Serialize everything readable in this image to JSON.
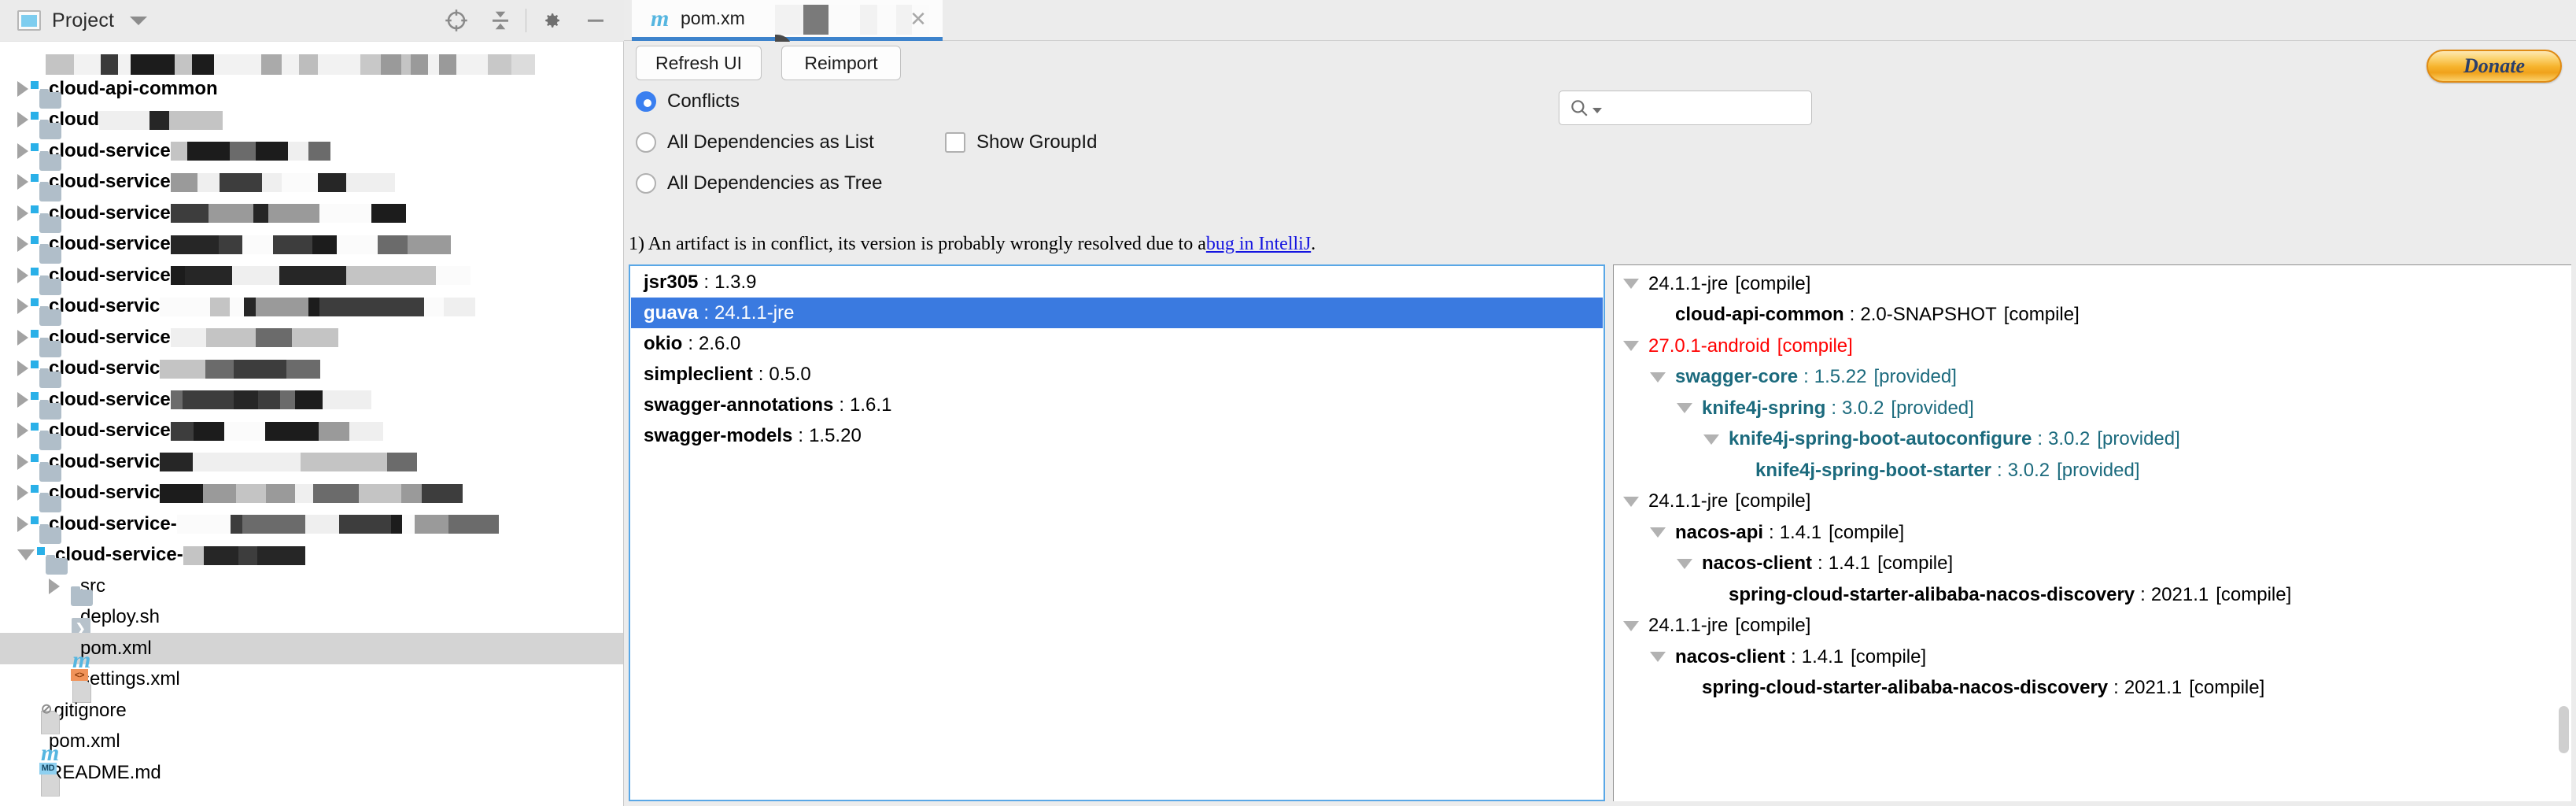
{
  "sidebar": {
    "tab_label": "Project",
    "icons": {
      "project": "project-window-icon",
      "locate": "locate-crosshair-icon",
      "collapse": "collapse-all-icon",
      "settings": "gear-icon",
      "minimize": "minimize-icon",
      "dropdown": "chevron-down-icon"
    },
    "tree": [
      {
        "label": "cloud-api-common",
        "indent": 0,
        "kind": "module",
        "state": "collapsed",
        "redacted": false
      },
      {
        "label": "cloud",
        "indent": 0,
        "kind": "module",
        "state": "collapsed",
        "redacted": true
      },
      {
        "label": "cloud-service",
        "indent": 0,
        "kind": "module",
        "state": "collapsed",
        "redacted": true
      },
      {
        "label": "cloud-service",
        "indent": 0,
        "kind": "module",
        "state": "collapsed",
        "redacted": true
      },
      {
        "label": "cloud-service",
        "indent": 0,
        "kind": "module",
        "state": "collapsed",
        "redacted": true
      },
      {
        "label": "cloud-service",
        "indent": 0,
        "kind": "module",
        "state": "collapsed",
        "redacted": true
      },
      {
        "label": "cloud-service",
        "indent": 0,
        "kind": "module",
        "state": "collapsed",
        "redacted": true
      },
      {
        "label": "cloud-servic",
        "indent": 0,
        "kind": "module",
        "state": "collapsed",
        "redacted": true
      },
      {
        "label": "cloud-service",
        "indent": 0,
        "kind": "module",
        "state": "collapsed",
        "redacted": true
      },
      {
        "label": "cloud-servic",
        "indent": 0,
        "kind": "module",
        "state": "collapsed",
        "redacted": true
      },
      {
        "label": "cloud-service",
        "indent": 0,
        "kind": "module",
        "state": "collapsed",
        "redacted": true
      },
      {
        "label": "cloud-service",
        "indent": 0,
        "kind": "module",
        "state": "collapsed",
        "redacted": true
      },
      {
        "label": "cloud-servic",
        "indent": 0,
        "kind": "module",
        "state": "collapsed",
        "redacted": true
      },
      {
        "label": "cloud-servic",
        "indent": 0,
        "kind": "module",
        "state": "collapsed",
        "redacted": true
      },
      {
        "label": "cloud-service-",
        "indent": 0,
        "kind": "module",
        "state": "collapsed",
        "redacted": true
      },
      {
        "label": "cloud-service-",
        "indent": 0,
        "kind": "module",
        "state": "expanded",
        "redacted": true
      },
      {
        "label": "src",
        "indent": 1,
        "kind": "folder",
        "state": "collapsed",
        "redacted": false
      },
      {
        "label": "deploy.sh",
        "indent": 1,
        "kind": "sh",
        "state": "leaf",
        "redacted": false
      },
      {
        "label": "pom.xml",
        "indent": 1,
        "kind": "maven",
        "state": "leaf",
        "redacted": false,
        "selected": true
      },
      {
        "label": "settings.xml",
        "indent": 1,
        "kind": "xml",
        "state": "leaf",
        "redacted": false
      },
      {
        "label": ".gitignore",
        "indent": 0,
        "kind": "gitignore",
        "state": "leaf",
        "redacted": false
      },
      {
        "label": "pom.xml",
        "indent": 0,
        "kind": "maven",
        "state": "leaf",
        "redacted": false
      },
      {
        "label": "README.md",
        "indent": 0,
        "kind": "markdown",
        "state": "leaf",
        "redacted": false
      }
    ]
  },
  "editor": {
    "tab": {
      "label": "pom.xm",
      "icon": "maven-file-icon",
      "close_icon": "close-icon"
    },
    "toolbar": {
      "refresh_label": "Refresh UI",
      "reimport_label": "Reimport",
      "donate_label": "Donate"
    },
    "options": {
      "conflicts_label": "Conflicts",
      "all_list_label": "All Dependencies as List",
      "all_tree_label": "All Dependencies as Tree",
      "show_groupid_label": "Show GroupId",
      "selected_mode": "Conflicts",
      "show_groupid_checked": false
    },
    "search": {
      "value": "",
      "placeholder": "",
      "icon": "search-icon"
    },
    "notice": {
      "prefix": "1) An artifact is in conflict, its version is probably wrongly resolved due to a ",
      "link": "bug in IntelliJ",
      "suffix": "."
    }
  },
  "dependency_list": {
    "items": [
      {
        "name": "jsr305",
        "version": "1.3.9",
        "selected": false
      },
      {
        "name": "guava",
        "version": "24.1.1-jre",
        "selected": true
      },
      {
        "name": "okio",
        "version": "2.6.0",
        "selected": false
      },
      {
        "name": "simpleclient",
        "version": "0.5.0",
        "selected": false
      },
      {
        "name": "swagger-annotations",
        "version": "1.6.1",
        "selected": false
      },
      {
        "name": "swagger-models",
        "version": "1.5.20",
        "selected": false
      }
    ],
    "separator": ":"
  },
  "dependency_tree": {
    "nodes": [
      {
        "indent": 0,
        "toggle": "expanded",
        "name": "",
        "version": "24.1.1-jre",
        "scope": "[compile]",
        "color": "black"
      },
      {
        "indent": 1,
        "toggle": "none",
        "name": "cloud-api-common",
        "version": "2.0-SNAPSHOT",
        "scope": "[compile]",
        "color": "black"
      },
      {
        "indent": 0,
        "toggle": "expanded",
        "name": "",
        "version": "27.0.1-android",
        "scope": "[compile]",
        "color": "red"
      },
      {
        "indent": 1,
        "toggle": "expanded",
        "name": "swagger-core",
        "version": "1.5.22",
        "scope": "[provided]",
        "color": "teal"
      },
      {
        "indent": 2,
        "toggle": "expanded",
        "name": "knife4j-spring",
        "version": "3.0.2",
        "scope": "[provided]",
        "color": "teal"
      },
      {
        "indent": 3,
        "toggle": "expanded",
        "name": "knife4j-spring-boot-autoconfigure",
        "version": "3.0.2",
        "scope": "[provided]",
        "color": "teal"
      },
      {
        "indent": 4,
        "toggle": "none",
        "name": "knife4j-spring-boot-starter",
        "version": "3.0.2",
        "scope": "[provided]",
        "color": "teal"
      },
      {
        "indent": 0,
        "toggle": "expanded",
        "name": "",
        "version": "24.1.1-jre",
        "scope": "[compile]",
        "color": "black"
      },
      {
        "indent": 1,
        "toggle": "expanded",
        "name": "nacos-api",
        "version": "1.4.1",
        "scope": "[compile]",
        "color": "black"
      },
      {
        "indent": 2,
        "toggle": "expanded",
        "name": "nacos-client",
        "version": "1.4.1",
        "scope": "[compile]",
        "color": "black"
      },
      {
        "indent": 3,
        "toggle": "none",
        "name": "spring-cloud-starter-alibaba-nacos-discovery",
        "version": "2021.1",
        "scope": "[compile]",
        "color": "black"
      },
      {
        "indent": 0,
        "toggle": "expanded",
        "name": "",
        "version": "24.1.1-jre",
        "scope": "[compile]",
        "color": "black"
      },
      {
        "indent": 1,
        "toggle": "expanded",
        "name": "nacos-client",
        "version": "1.4.1",
        "scope": "[compile]",
        "color": "black"
      },
      {
        "indent": 2,
        "toggle": "none",
        "name": "spring-cloud-starter-alibaba-nacos-discovery",
        "version": "2021.1",
        "scope": "[compile]",
        "color": "black"
      }
    ],
    "separator": ":"
  },
  "colors": {
    "accent_blue": "#3a7ae0",
    "conflict_red": "#ff0000",
    "tree_teal": "#1b6a7d",
    "link_blue": "#1414e0",
    "module_badge": "#2ab0e8",
    "donate_orange": "#f0a21b"
  }
}
